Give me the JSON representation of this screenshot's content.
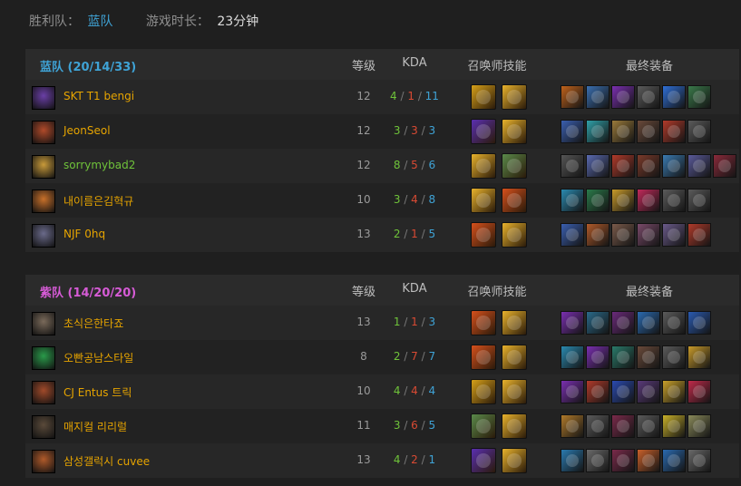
{
  "summary": {
    "winner_label": "胜利队：",
    "winner_value": "蓝队",
    "duration_label": "游戏时长：",
    "duration_value": "23分钟"
  },
  "columns": {
    "level": "等级",
    "kda": "KDA",
    "spells": "召唤师技能",
    "items": "最终装备"
  },
  "teams": [
    {
      "name": "蓝队 (20/14/33)",
      "color": "#3fa3d6",
      "players": [
        {
          "name": "SKT T1 bengi",
          "name_color": "orange",
          "level": "12",
          "k": "4",
          "d": "1",
          "a": "11",
          "avatar": "#6a3fa6",
          "spells": [
            "#d6a019",
            "#e8b22c"
          ],
          "items": [
            "#c0621b",
            "#3a6fb0",
            "#7a2fb0",
            "#5b5b5b",
            "#2f6fd6",
            "#3a7a4a"
          ]
        },
        {
          "name": "JeonSeol",
          "name_color": "orange",
          "level": "12",
          "k": "3",
          "d": "3",
          "a": "3",
          "avatar": "#b04a2a",
          "spells": [
            "#5a2fb0",
            "#e8b22c"
          ],
          "items": [
            "#3a5fb0",
            "#30a0a8",
            "#9a7a3a",
            "#6a4a3a",
            "#b03a2a",
            "#5b5b5b"
          ]
        },
        {
          "name": "sorrymybad2",
          "name_color": "green",
          "level": "12",
          "k": "8",
          "d": "5",
          "a": "6",
          "avatar": "#c89a3a",
          "spells": [
            "#e8b22c",
            "#5a8a4a"
          ],
          "items": [
            "#555555",
            "#5a6ab0",
            "#b03a2a",
            "#7a3a2a",
            "#3a7ab0",
            "#5a5a9a",
            "#8a2a3a"
          ]
        },
        {
          "name": "내이름은김혁규",
          "name_color": "orange",
          "level": "10",
          "k": "3",
          "d": "4",
          "a": "8",
          "avatar": "#c8702a",
          "spells": [
            "#e8b22c",
            "#d6501c"
          ],
          "items": [
            "#2a8ab0",
            "#2a7a4a",
            "#c89a2a",
            "#c02a5a",
            "#5b5b5b",
            "#5b5b5b"
          ]
        },
        {
          "name": "NJF 0hq",
          "name_color": "orange",
          "level": "13",
          "k": "2",
          "d": "1",
          "a": "5",
          "avatar": "#6a6a8a",
          "spells": [
            "#d6501c",
            "#e8b22c"
          ],
          "items": [
            "#3a5fb0",
            "#b05a2a",
            "#7a5a4a",
            "#7a4a6a",
            "#6a5a8a",
            "#b03a2a"
          ]
        }
      ]
    },
    {
      "name": "紫队 (14/20/20)",
      "color": "#d65bd6",
      "players": [
        {
          "name": "초식은한타죠",
          "name_color": "orange",
          "level": "13",
          "k": "1",
          "d": "1",
          "a": "3",
          "avatar": "#7a6a5a",
          "spells": [
            "#d6501c",
            "#e8b22c"
          ],
          "items": [
            "#7a2fb0",
            "#2a6a8a",
            "#6a2a7a",
            "#2a6ab0",
            "#5b5b5b",
            "#2a5ab0"
          ]
        },
        {
          "name": "오빤공남스타일",
          "name_color": "orange",
          "level": "8",
          "k": "2",
          "d": "7",
          "a": "7",
          "avatar": "#2a9a4a",
          "spells": [
            "#d6501c",
            "#e8b22c"
          ],
          "items": [
            "#2a8ab0",
            "#7a2fb0",
            "#2a7a6a",
            "#6a4a3a",
            "#5b5b5b",
            "#c89a2a"
          ]
        },
        {
          "name": "CJ Entus 트릭",
          "name_color": "orange",
          "level": "10",
          "k": "4",
          "d": "4",
          "a": "4",
          "avatar": "#a04a2a",
          "spells": [
            "#d6a019",
            "#e8b22c"
          ],
          "items": [
            "#7a2fb0",
            "#b03a2a",
            "#2a4ab0",
            "#5a3a7a",
            "#c8a02a",
            "#c02a4a"
          ]
        },
        {
          "name": "매지컬 리리럴",
          "name_color": "orange",
          "level": "11",
          "k": "3",
          "d": "6",
          "a": "5",
          "avatar": "#5a4a3a",
          "spells": [
            "#5a8a4a",
            "#e8b22c"
          ],
          "items": [
            "#b07a2a",
            "#5b5b5b",
            "#7a2a4a",
            "#5b5b5b",
            "#c8b02a",
            "#8a8a5a"
          ]
        },
        {
          "name": "삼성갤럭시 cuvee",
          "name_color": "orange",
          "level": "13",
          "k": "4",
          "d": "2",
          "a": "1",
          "avatar": "#b05a2a",
          "spells": [
            "#5a2fb0",
            "#e8b22c"
          ],
          "items": [
            "#2a7ab0",
            "#6a6a6a",
            "#7a2a4a",
            "#c8602a",
            "#2a6ab0",
            "#6a6a6a"
          ]
        }
      ]
    }
  ]
}
